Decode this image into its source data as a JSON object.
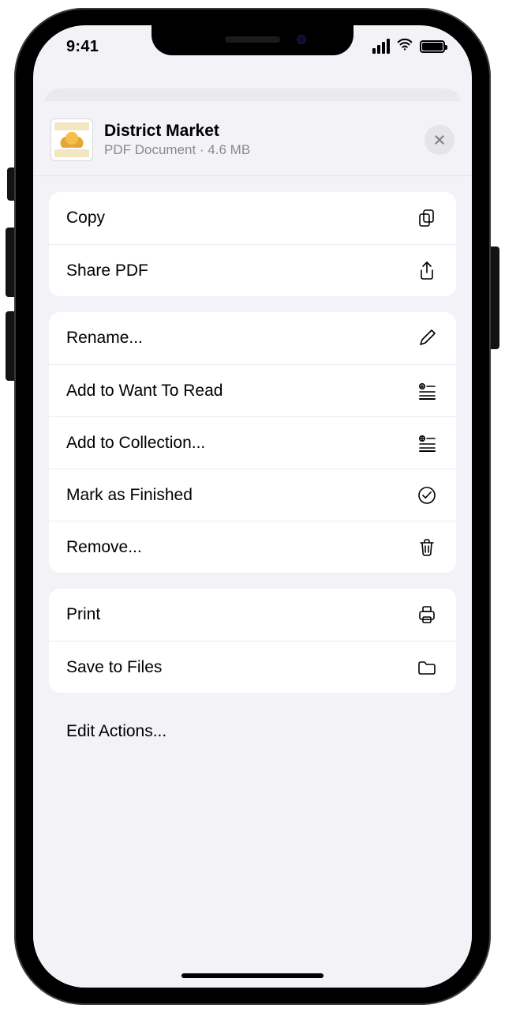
{
  "status": {
    "time": "9:41"
  },
  "doc": {
    "title": "District Market",
    "subtitle": "PDF Document · 4.6 MB"
  },
  "groups": [
    {
      "items": [
        {
          "name": "copy",
          "label": "Copy",
          "icon": "copy-icon"
        },
        {
          "name": "share-pdf",
          "label": "Share PDF",
          "icon": "share-icon"
        }
      ]
    },
    {
      "items": [
        {
          "name": "rename",
          "label": "Rename...",
          "icon": "pencil-icon"
        },
        {
          "name": "want-to-read",
          "label": "Add to Want To Read",
          "icon": "star-list-icon"
        },
        {
          "name": "collection",
          "label": "Add to Collection...",
          "icon": "plus-list-icon"
        },
        {
          "name": "finished",
          "label": "Mark as Finished",
          "icon": "check-circle-icon"
        },
        {
          "name": "remove",
          "label": "Remove...",
          "icon": "trash-icon"
        }
      ]
    },
    {
      "items": [
        {
          "name": "print",
          "label": "Print",
          "icon": "printer-icon"
        },
        {
          "name": "save-to-files",
          "label": "Save to Files",
          "icon": "folder-icon"
        }
      ]
    }
  ],
  "editActions": "Edit Actions..."
}
